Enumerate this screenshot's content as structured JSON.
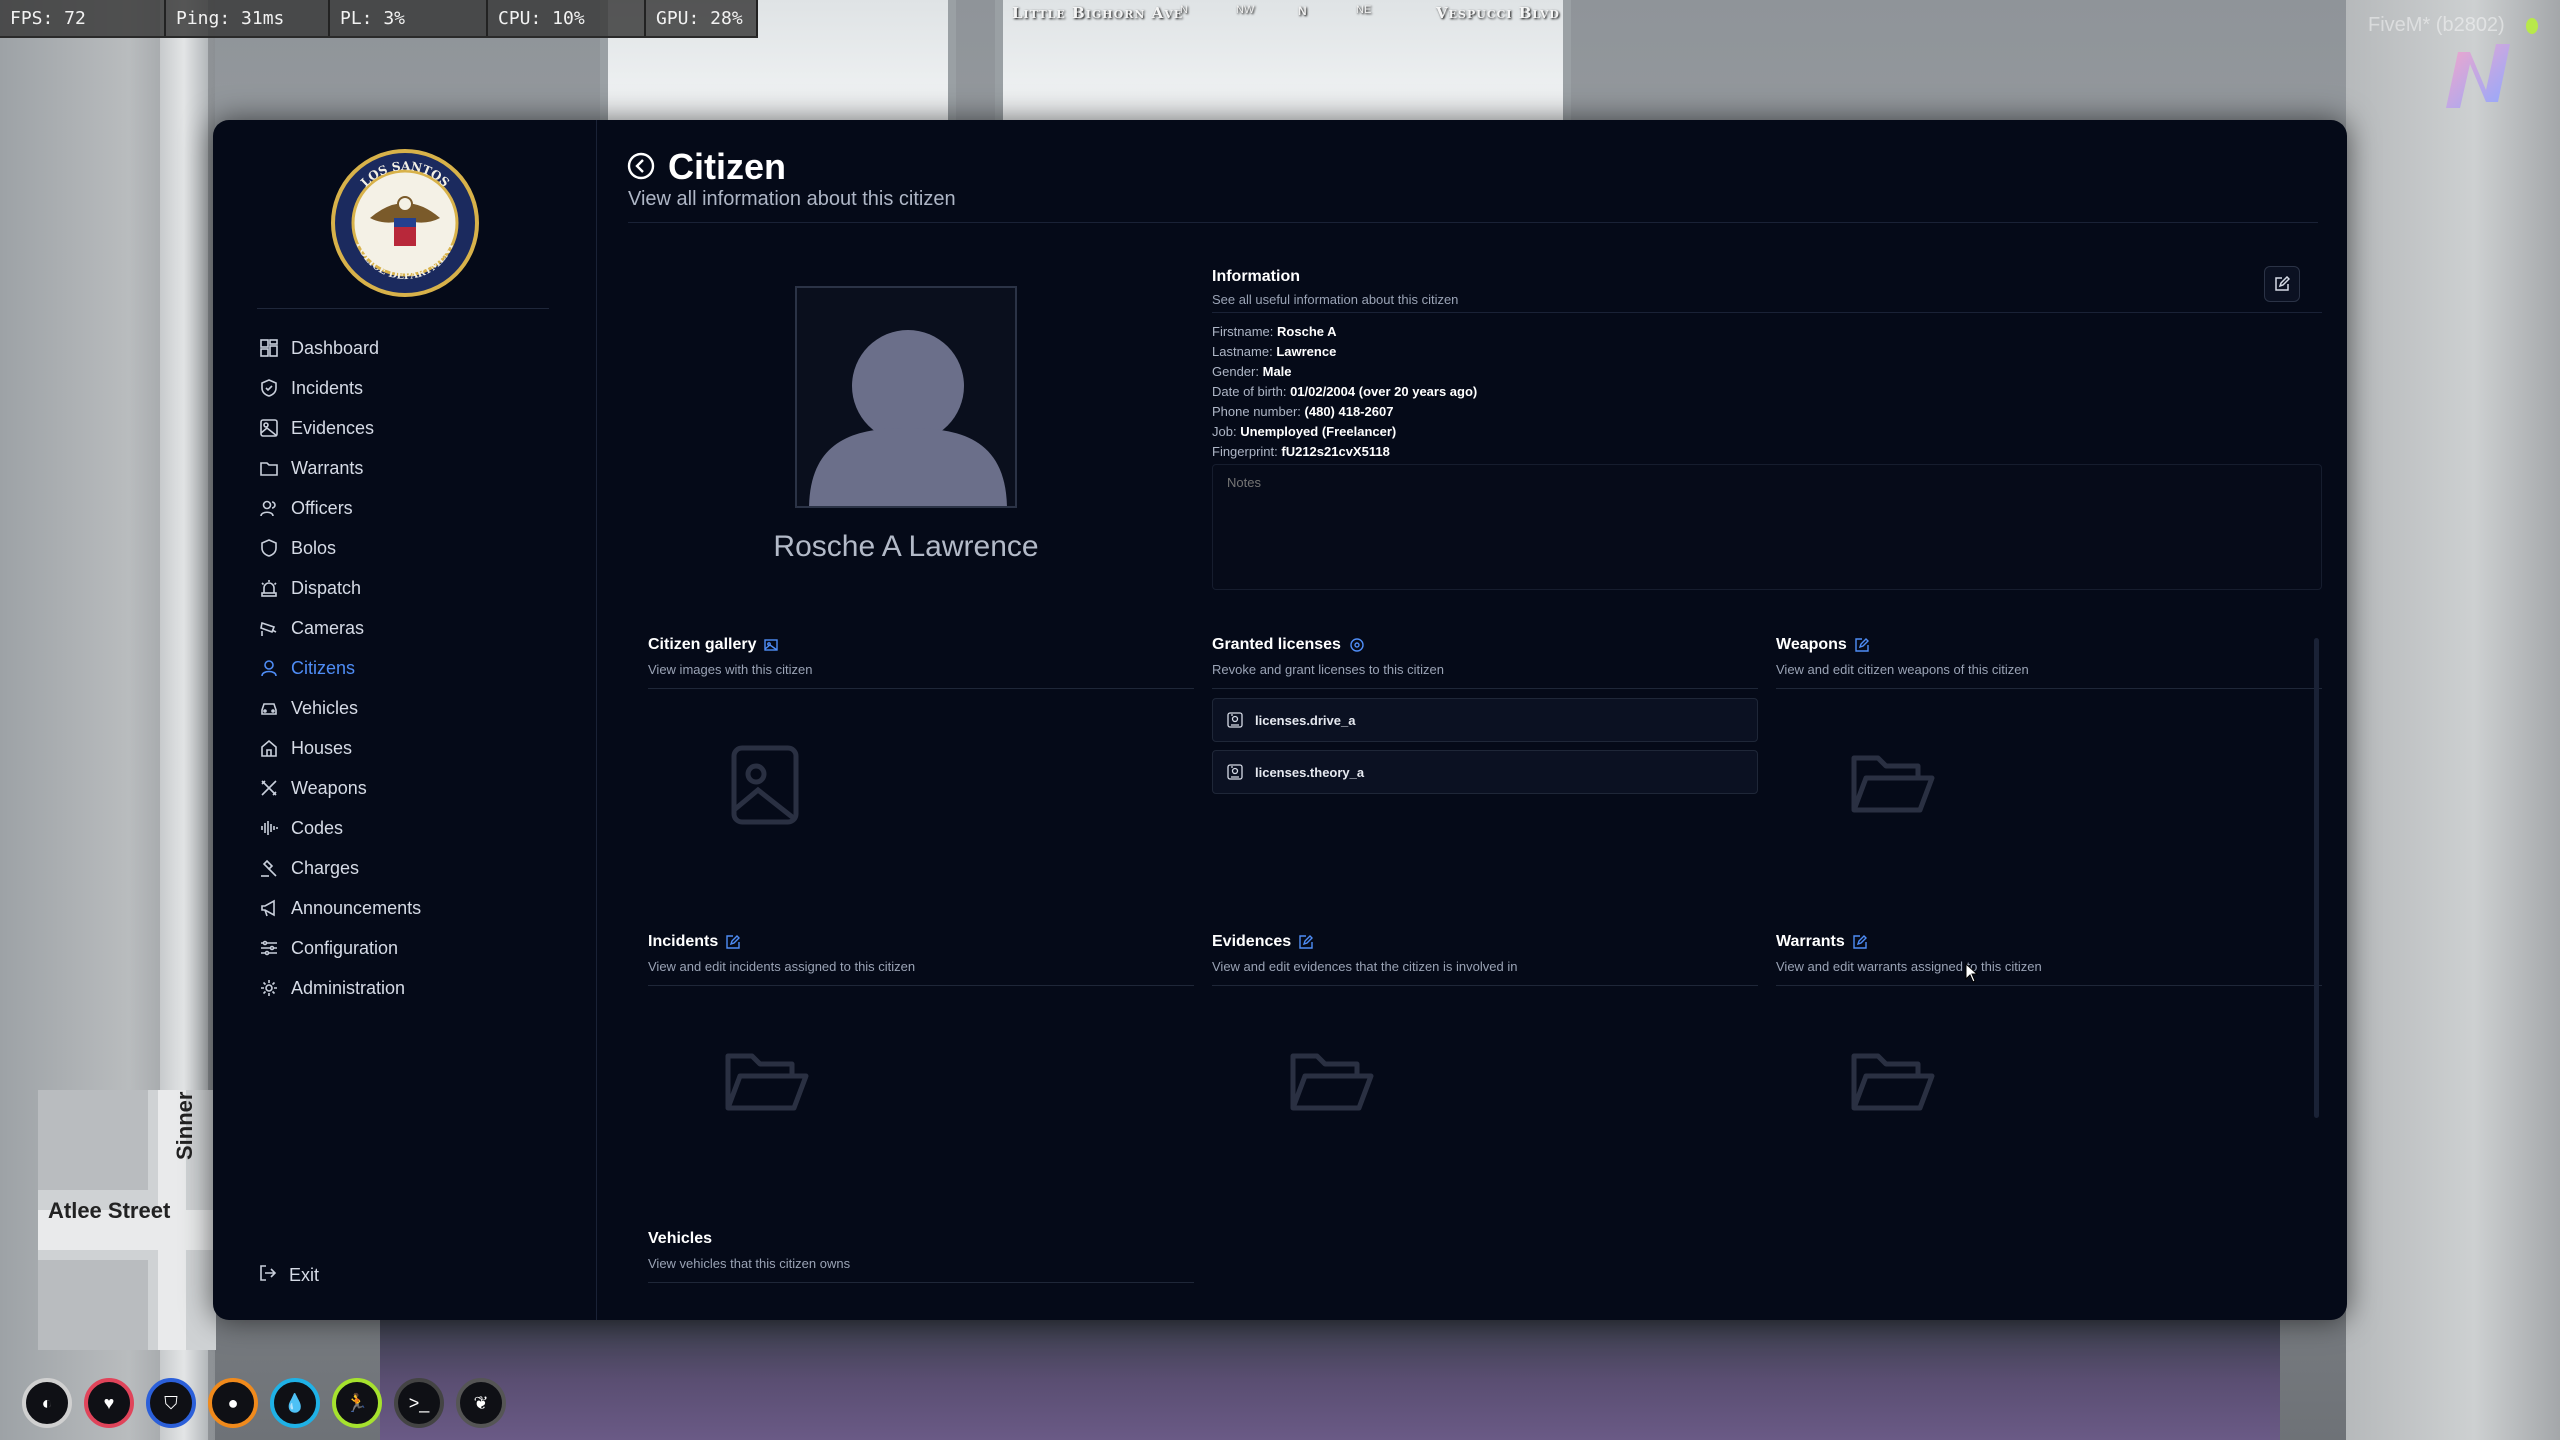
{
  "perf": {
    "fps": "FPS: 72",
    "ping": "Ping: 31ms",
    "pl": "PL: 3%",
    "cpu": "CPU: 10%",
    "gpu": "GPU: 28%"
  },
  "location": {
    "street_left": "Little Bighorn Ave",
    "street_right": "Vespucci Blvd",
    "compass": [
      "N",
      "NW",
      "N",
      "NE"
    ]
  },
  "fivem_tag": "FiveM* (b2802)",
  "minimap": {
    "street_h": "Atlee Street",
    "street_v": "Sinner"
  },
  "sidebar": {
    "items": [
      {
        "label": "Dashboard",
        "icon": "dashboard-icon"
      },
      {
        "label": "Incidents",
        "icon": "shield-icon"
      },
      {
        "label": "Evidences",
        "icon": "image-icon"
      },
      {
        "label": "Warrants",
        "icon": "folder-icon"
      },
      {
        "label": "Officers",
        "icon": "users-icon"
      },
      {
        "label": "Bolos",
        "icon": "shield-icon"
      },
      {
        "label": "Dispatch",
        "icon": "siren-icon"
      },
      {
        "label": "Cameras",
        "icon": "cctv-icon"
      },
      {
        "label": "Citizens",
        "icon": "user-icon",
        "active": true
      },
      {
        "label": "Vehicles",
        "icon": "car-icon"
      },
      {
        "label": "Houses",
        "icon": "house-icon"
      },
      {
        "label": "Weapons",
        "icon": "crosshair-icon"
      },
      {
        "label": "Codes",
        "icon": "audio-lines-icon"
      },
      {
        "label": "Charges",
        "icon": "gavel-icon"
      },
      {
        "label": "Announcements",
        "icon": "megaphone-icon"
      },
      {
        "label": "Configuration",
        "icon": "sliders-icon"
      },
      {
        "label": "Administration",
        "icon": "cog-icon"
      }
    ],
    "exit_label": "Exit"
  },
  "header": {
    "title": "Citizen",
    "subtitle": "View all information about this citizen"
  },
  "citizen": {
    "full_name": "Rosche A Lawrence"
  },
  "information": {
    "title": "Information",
    "subtitle": "See all useful information about this citizen",
    "fields": [
      {
        "label": "Firstname:",
        "value": "Rosche A"
      },
      {
        "label": "Lastname:",
        "value": "Lawrence"
      },
      {
        "label": "Gender:",
        "value": "Male"
      },
      {
        "label": "Date of birth:",
        "value": "01/02/2004 (over 20 years ago)"
      },
      {
        "label": "Phone number:",
        "value": "(480) 418-2607"
      },
      {
        "label": "Job:",
        "value": "Unemployed (Freelancer)"
      },
      {
        "label": "Fingerprint:",
        "value": "fU212s21cvX5118"
      }
    ],
    "notes_placeholder": "Notes"
  },
  "sections": {
    "gallery": {
      "title": "Citizen gallery",
      "subtitle": "View images with this citizen"
    },
    "licenses": {
      "title": "Granted licenses",
      "subtitle": "Revoke and grant licenses to this citizen",
      "items": [
        "licenses.drive_a",
        "licenses.theory_a"
      ]
    },
    "weapons": {
      "title": "Weapons",
      "subtitle": "View and edit citizen weapons of this citizen"
    },
    "incidents": {
      "title": "Incidents",
      "subtitle": "View and edit incidents assigned to this citizen"
    },
    "evidences": {
      "title": "Evidences",
      "subtitle": "View and edit evidences that the citizen is involved in"
    },
    "warrants": {
      "title": "Warrants",
      "subtitle": "View and edit warrants assigned to this citizen"
    },
    "vehicles": {
      "title": "Vehicles",
      "subtitle": "View vehicles that this citizen owns"
    }
  },
  "colors": {
    "background": "#050a18",
    "accent": "#4f8df6",
    "text": "#e6e9f0",
    "muted": "#9aa3b5"
  },
  "hud": [
    {
      "icon": "voice-icon",
      "color": "#d0d0d0"
    },
    {
      "icon": "heart-icon",
      "color": "#e0445a"
    },
    {
      "icon": "armor-icon",
      "color": "#2b5fd9"
    },
    {
      "icon": "food-icon",
      "color": "#f08a1c"
    },
    {
      "icon": "water-icon",
      "color": "#1fb1e6"
    },
    {
      "icon": "stamina-icon",
      "color": "#a6e22e"
    },
    {
      "icon": "terminal-icon",
      "color": "#444444"
    },
    {
      "icon": "leaf-icon",
      "color": "#555555"
    }
  ]
}
